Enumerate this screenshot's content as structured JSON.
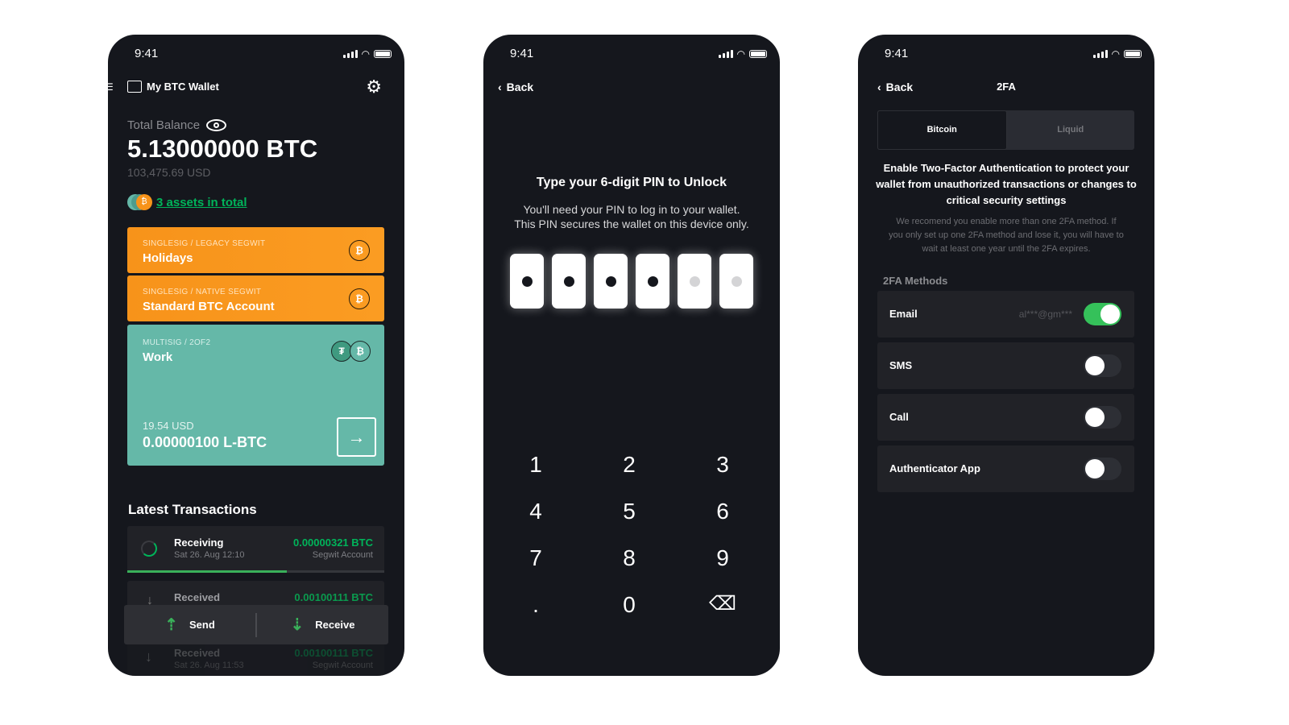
{
  "status": {
    "time": "9:41"
  },
  "wallet": {
    "title": "My BTC Wallet",
    "balance_label": "Total Balance",
    "balance": "5.13000000 BTC",
    "balance_fiat": "103,475.69 USD",
    "assets_link": "3 assets in total",
    "accounts": [
      {
        "type": "SINGLESIG / LEGACY SEGWIT",
        "name": "Holidays",
        "coins": [
          "₿"
        ]
      },
      {
        "type": "SINGLESIG / NATIVE SEGWIT",
        "name": "Standard BTC Account",
        "coins": [
          "₿"
        ]
      },
      {
        "type": "MULTISIG / 2OF2",
        "name": "Work",
        "coins": [
          "₮",
          "₿"
        ],
        "fiat": "19.54 USD",
        "amount": "0.00000100 L-BTC"
      }
    ],
    "transactions_title": "Latest Transactions",
    "transactions": [
      {
        "status": "Receiving",
        "date": "Sat 26. Aug 12:10",
        "amount": "0.00000321 BTC",
        "account": "Segwit Account",
        "progress": 0.62
      },
      {
        "status": "Received",
        "date": "",
        "amount": "0.00100111 BTC",
        "account": ""
      },
      {
        "status": "Received",
        "date": "Sat 26. Aug 11:53",
        "amount": "0.00100111 BTC",
        "account": "Segwit Account"
      }
    ],
    "send": "Send",
    "receive": "Receive"
  },
  "pin": {
    "back": "Back",
    "title": "Type your 6-digit PIN to Unlock",
    "desc1": "You'll need your PIN to log in to your wallet.",
    "desc2": "This PIN secures the wallet on this device only.",
    "filled": 4,
    "length": 6,
    "keys": [
      "1",
      "2",
      "3",
      "4",
      "5",
      "6",
      "7",
      "8",
      "9",
      ".",
      "0",
      "⌫"
    ]
  },
  "twofa": {
    "back": "Back",
    "title": "2FA",
    "tabs": [
      "Bitcoin",
      "Liquid"
    ],
    "active_tab": "Bitcoin",
    "heading": "Enable Two-Factor Authentication to protect your wallet from unauthorized transactions or changes to critical security settings",
    "note": "We recomend you enable more than one 2FA method. If you only set up one 2FA method and lose it, you will have to wait at least one year until the 2FA expires.",
    "methods_label": "2FA Methods",
    "methods": [
      {
        "name": "Email",
        "value": "al***@gm***",
        "enabled": true
      },
      {
        "name": "SMS",
        "value": "",
        "enabled": false
      },
      {
        "name": "Call",
        "value": "",
        "enabled": false
      },
      {
        "name": "Authenticator App",
        "value": "",
        "enabled": false
      }
    ]
  },
  "colors": {
    "accent": "#00b45a",
    "orange": "#f7931a",
    "teal": "#65b8a8",
    "bg": "#15171d"
  }
}
